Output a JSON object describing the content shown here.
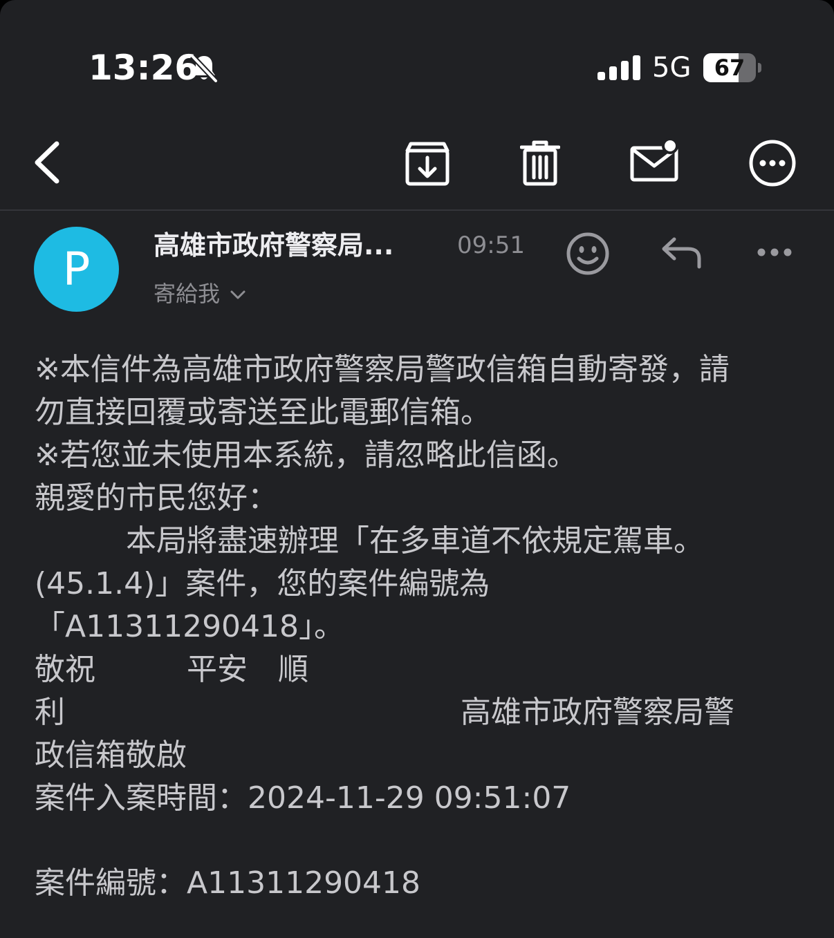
{
  "status_bar": {
    "time": "13:26",
    "network": "5G",
    "battery_percent": "67",
    "battery_level": 0.67,
    "bell_icon": "bell-slash-icon",
    "signal_icon": "cellular-signal-icon"
  },
  "toolbar": {
    "icons": [
      "chevron-left-icon",
      "archive-download-icon",
      "trash-icon",
      "mail-unread-icon",
      "more-circle-icon"
    ]
  },
  "message": {
    "avatar_letter": "P",
    "avatar_color": "#1ebbe3",
    "sender": "高雄市政府警察局...",
    "time": "09:51",
    "recipient": "寄給我",
    "header_icons": [
      "smiley-icon",
      "reply-icon",
      "more-horizontal-icon"
    ]
  },
  "body": {
    "lines": [
      "※本信件為高雄市政府警察局警政信箱自動寄發，請",
      "勿直接回覆或寄送至此電郵信箱。",
      "※若您並未使用本系統，請忽略此信函。",
      "親愛的市民您好：",
      "　　　本局將盡速辦理「在多車道不依規定駕車。",
      "(45.1.4)」案件，您的案件編號為",
      "「A11311290418」。",
      " 敬祝　　　平安　順",
      "利　　　　　　　　　　　　　高雄市政府警察局警",
      "政信箱敬啟",
      "案件入案時間：2024-11-29 09:51:07",
      "",
      "案件編號：A11311290418"
    ]
  },
  "colors": {
    "background": "#202124",
    "body_text": "#c8c8cc",
    "secondary_text": "#8e8e93"
  }
}
